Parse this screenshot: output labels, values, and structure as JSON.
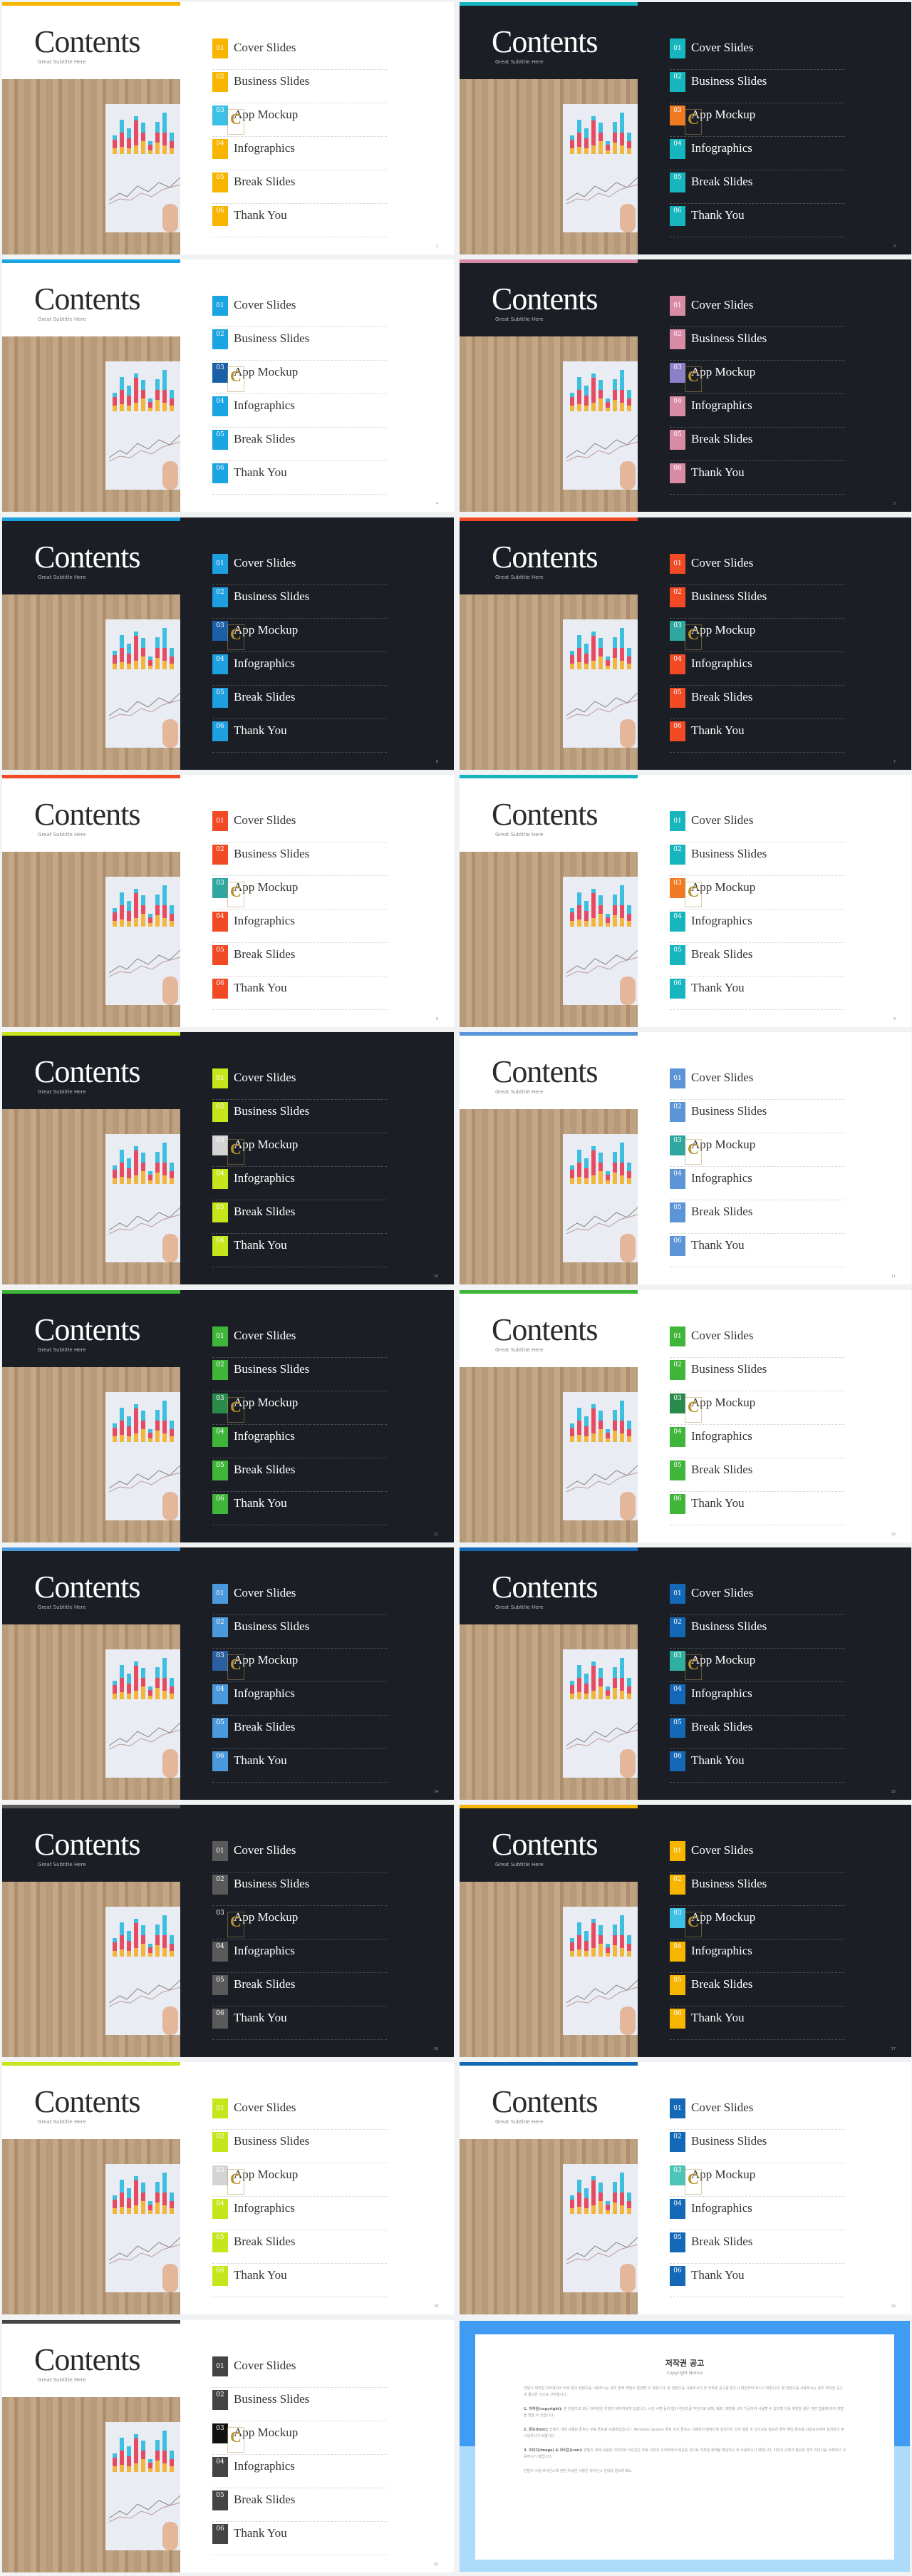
{
  "contents": {
    "title": "Contents",
    "subtitle": "Great Subtitle Here",
    "items": [
      {
        "num": "01",
        "label": "Cover Slides"
      },
      {
        "num": "02",
        "label": "Business Slides"
      },
      {
        "num": "03",
        "label": "App Mockup"
      },
      {
        "num": "04",
        "label": "Infographics"
      },
      {
        "num": "05",
        "label": "Break Slides"
      },
      {
        "num": "06",
        "label": "Thank You"
      }
    ],
    "watermark": "C"
  },
  "slides": [
    {
      "theme": "light",
      "accent": "#f7b500",
      "alt": "#3cc0e6",
      "page": "2"
    },
    {
      "theme": "dark",
      "accent": "#17b6bf",
      "alt": "#f07a22",
      "page": "3"
    },
    {
      "theme": "light",
      "accent": "#19a4e2",
      "alt": "#1a5fa8",
      "page": "4"
    },
    {
      "theme": "dark",
      "accent": "#d98aa4",
      "alt": "#8e7fc9",
      "page": "5"
    },
    {
      "theme": "dark",
      "accent": "#1d9fe0",
      "alt": "#1a5fa8",
      "page": "6"
    },
    {
      "theme": "dark",
      "accent": "#f24a25",
      "alt": "#2fa7a0",
      "page": "7"
    },
    {
      "theme": "light",
      "accent": "#f24a25",
      "alt": "#2fa7a0",
      "page": "8"
    },
    {
      "theme": "light",
      "accent": "#17b6bf",
      "alt": "#f07a22",
      "page": "9"
    },
    {
      "theme": "dark",
      "accent": "#c6e51a",
      "alt": "#d4d4d4",
      "page": "10"
    },
    {
      "theme": "light",
      "accent": "#5b95d8",
      "alt": "#2fa7a0",
      "page": "11"
    },
    {
      "theme": "dark",
      "accent": "#3fb53a",
      "alt": "#2a8a4a",
      "page": "12"
    },
    {
      "theme": "light",
      "accent": "#3fb53a",
      "alt": "#2a8a4a",
      "page": "13"
    },
    {
      "theme": "dark",
      "accent": "#4b98dc",
      "alt": "#2a5fa0",
      "page": "14"
    },
    {
      "theme": "dark",
      "accent": "#1468b8",
      "alt": "#2fb0a0",
      "page": "15"
    },
    {
      "theme": "dark",
      "accent": "#5a5a5a",
      "alt": "#1b1e24",
      "page": "16"
    },
    {
      "theme": "dark",
      "accent": "#f7b500",
      "alt": "#3cc0e6",
      "page": "17"
    },
    {
      "theme": "light",
      "accent": "#c6e51a",
      "alt": "#d4d4d4",
      "page": "18"
    },
    {
      "theme": "light",
      "accent": "#1468b8",
      "alt": "#4cc4b8",
      "page": "19"
    },
    {
      "theme": "light",
      "accent": "#444444",
      "alt": "#111111",
      "page": "20"
    }
  ],
  "copyright": {
    "title": "저작권 공고",
    "subtitle": "Copyright Notice",
    "intro": "컨텐츠 제작업 저작권자의 허락 없이 컨텐츠를 사용하시는 경우 법적 책임이 발생할 수 있습니다. 본 컨텐츠를 사용하시기 전 저작권 공고를 반드시 확인하여 주시기 바랍니다. 본 컨텐츠를 사용하시는 경우 저작권 공고에 동의한 것으로 간주합니다.",
    "sections": [
      {
        "head": "1. 저작권(copyright):",
        "body": "본 컨텐츠의 모든 저작권은 컨텐츠 제작자에게 있습니다. 사전 서면 동의 없이 컨텐츠를 무단으로 복제, 배포, 재판매, 2차 가공하여 사용할 수 없으며 이를 위반할 경우 관련 법률에 따라 처벌을 받을 수 있습니다."
      },
      {
        "head": "2. 폰트(font):",
        "body": "컨텐츠 내에 사용된 폰트는 무료 폰트를 사용하였습니다. Windows System 폰트 외의 폰트는 사용자의 컴퓨터에 설치되어 있지 않을 수 있으므로 필요한 경우 해당 폰트를 다운로드하여 설치하신 후 사용하시기 바랍니다."
      },
      {
        "head": "3. 이미지(image) & 아이콘(icon):",
        "body": "컨텐츠 내에 사용된 이미지와 아이콘은 무료 이미지 사이트에서 제공된 것으로 저작권 정책을 확인하신 후 사용하시기 바랍니다. 이미지 교체가 필요한 경우 이미지를 삭제하고 사용하시기 바랍니다."
      }
    ],
    "outro": "컨텐츠 사용 라이선스에 관한 자세한 사항은 라이선스 안내를 참고하세요."
  }
}
